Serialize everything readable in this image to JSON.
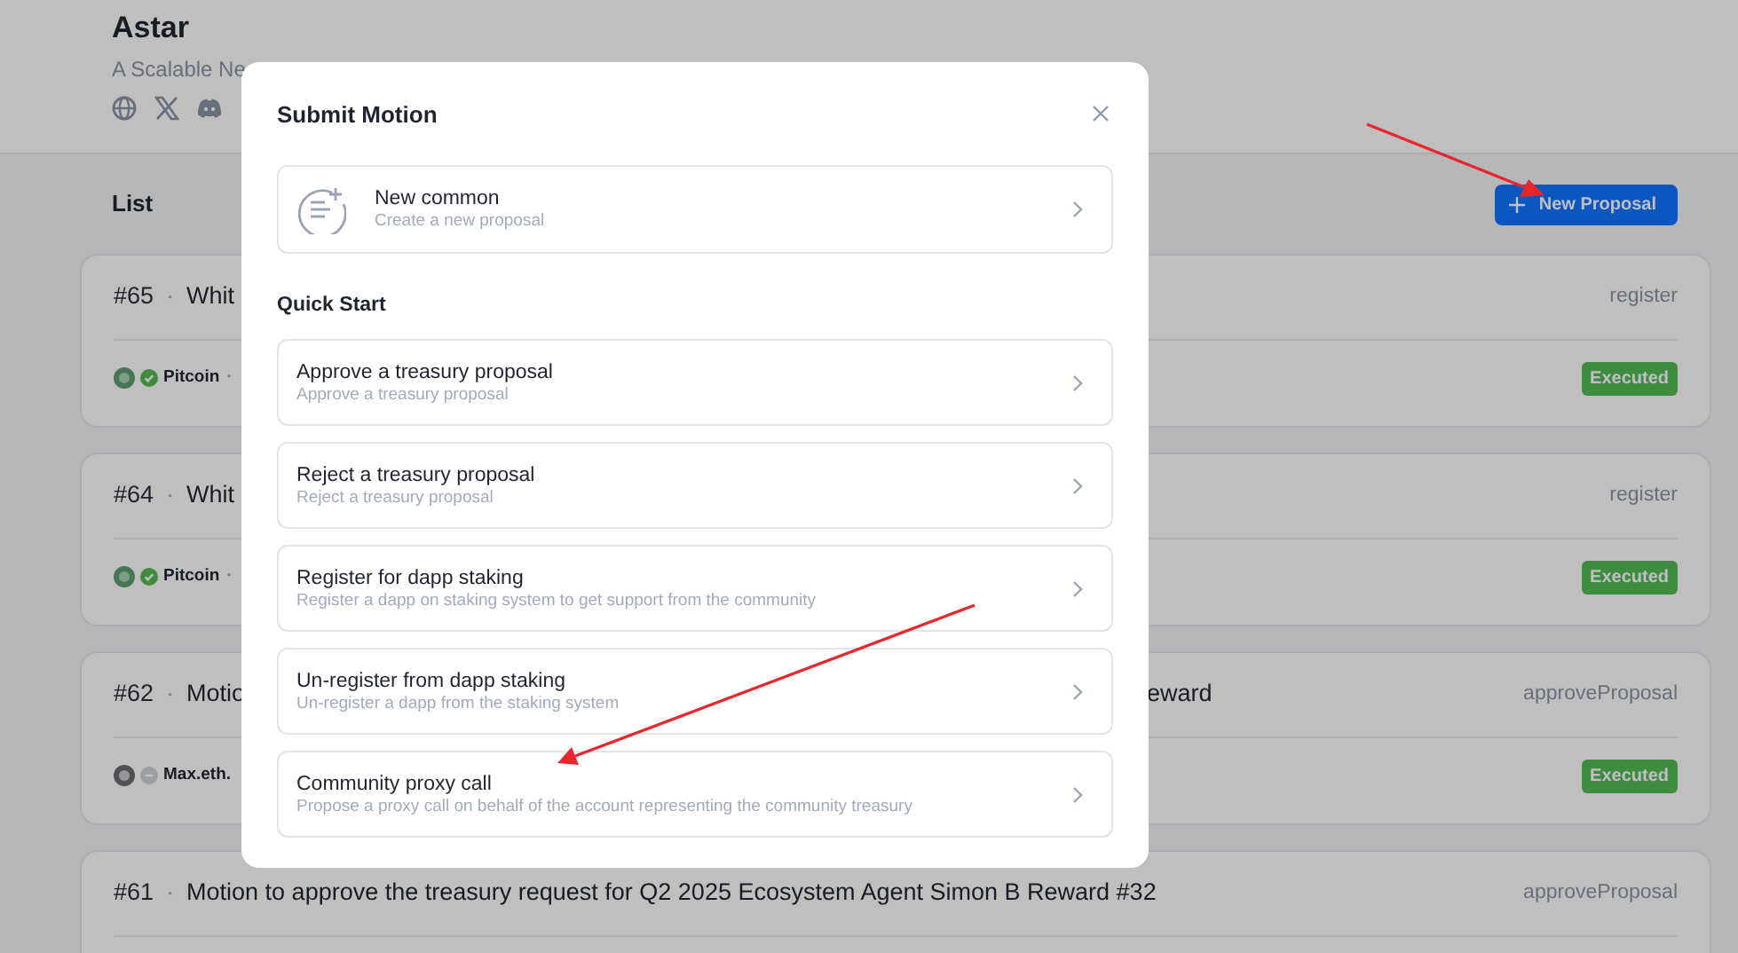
{
  "header": {
    "title": "Astar",
    "subtitle": "A Scalable Ne",
    "links": [
      {
        "kind": "globe"
      },
      {
        "kind": "x"
      },
      {
        "kind": "discord"
      }
    ]
  },
  "list": {
    "title": "List",
    "button": "New Proposal"
  },
  "motions": [
    {
      "number": "#65",
      "separator": "·",
      "title": "Whit",
      "method": "register",
      "author": {
        "name": "Pitcoin",
        "verified": true,
        "separator": "·"
      },
      "status": "Executed"
    },
    {
      "number": "#64",
      "separator": "·",
      "title": "Whit",
      "method": "register",
      "author": {
        "name": "Pitcoin",
        "verified": true,
        "separator": "·"
      },
      "status": "Executed"
    },
    {
      "number": "#62",
      "separator": "·",
      "title": "Motio",
      "title_end": "eward",
      "method": "approveProposal",
      "author": {
        "name": "Max.eth.",
        "verified": false
      },
      "status": "Executed"
    },
    {
      "number": "#61",
      "separator": "·",
      "title": "Motion to approve the treasury request for Q2 2025 Ecosystem Agent Simon B Reward #32",
      "method": "approveProposal"
    }
  ],
  "modal": {
    "title": "Submit Motion",
    "primary": {
      "title": "New common",
      "description": "Create a new proposal"
    },
    "section": "Quick Start",
    "options": [
      {
        "title": "Approve a treasury proposal",
        "description": "Approve a treasury proposal"
      },
      {
        "title": "Reject a treasury proposal",
        "description": "Reject a treasury proposal"
      },
      {
        "title": "Register for dapp staking",
        "description": "Register a dapp on staking system to get support from the community"
      },
      {
        "title": "Un-register from dapp staking",
        "description": "Un-register a dapp from the staking system"
      },
      {
        "title": "Community proxy call",
        "description": "Propose a proxy call on behalf of the account representing the community treasury"
      }
    ]
  }
}
